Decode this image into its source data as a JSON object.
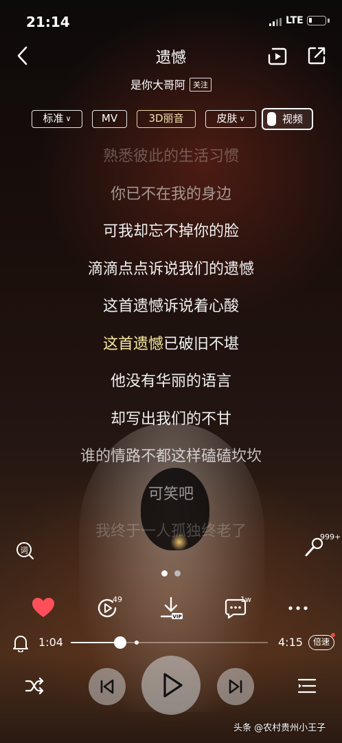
{
  "status_bar": {
    "time": "21:14",
    "network": "LTE",
    "battery_level": 0.2
  },
  "header": {
    "title": "遗憾",
    "artist": "是你大哥阿",
    "follow_label": "关注",
    "icons": {
      "back": "chevron-left-icon",
      "video": "video-frame-icon",
      "share": "share-out-icon"
    }
  },
  "options": {
    "quality": "标准",
    "mv": "MV",
    "sound": "3D丽音",
    "skin": "皮肤",
    "video": "视频"
  },
  "lyrics": {
    "lines": [
      "熟悉彼此的生活习惯",
      "你已不在我的身边",
      "可我却忘不掉你的脸",
      "滴滴点点诉说我们的遗憾",
      "这首遗憾诉说着心酸",
      "这首遗憾已破旧不堪",
      "他没有华丽的语言",
      "却写出我们的不甘",
      "谁的情路不都这样磕磕坎坎",
      "可笑吧",
      "我终于一人孤独终老了"
    ],
    "current_sung": "这首遗憾",
    "current_rest": "已破旧不堪",
    "highlight_color": "#f6e7a0"
  },
  "side": {
    "mic_count": "999+"
  },
  "actions": {
    "like_color": "#ff4f5a",
    "loop_count": "49",
    "download_tag": "VIP",
    "comment_count": "1w"
  },
  "progress": {
    "current": "1:04",
    "total": "4:15",
    "fraction": 0.251,
    "speed_label": "倍速"
  },
  "controls": {
    "shuffle": "shuffle-icon",
    "prev": "previous-icon",
    "play": "play-icon",
    "next": "next-icon",
    "playlist": "playlist-icon"
  },
  "watermark": "头条 @农村贵州小王子"
}
